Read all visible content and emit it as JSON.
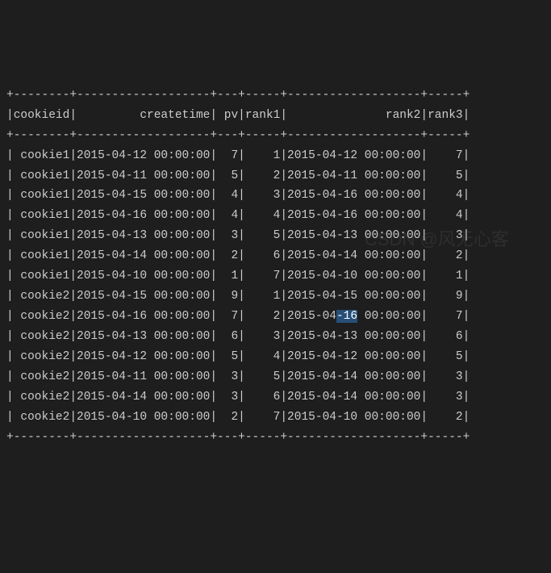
{
  "border": "+--------+-------------------+---+-----+-------------------+-----+",
  "header": "|cookieid|         createtime| pv|rank1|              rank2|rank3|",
  "watermark": "CSDN @风无心客",
  "highlight_row": 8,
  "highlight_text": "-16",
  "rows": [
    {
      "cookieid": "cookie1",
      "createtime": "2015-04-12 00:00:00",
      "pv": "7",
      "rank1": "1",
      "rank2": "2015-04-12 00:00:00",
      "rank3": "7"
    },
    {
      "cookieid": "cookie1",
      "createtime": "2015-04-11 00:00:00",
      "pv": "5",
      "rank1": "2",
      "rank2": "2015-04-11 00:00:00",
      "rank3": "5"
    },
    {
      "cookieid": "cookie1",
      "createtime": "2015-04-15 00:00:00",
      "pv": "4",
      "rank1": "3",
      "rank2": "2015-04-16 00:00:00",
      "rank3": "4"
    },
    {
      "cookieid": "cookie1",
      "createtime": "2015-04-16 00:00:00",
      "pv": "4",
      "rank1": "4",
      "rank2": "2015-04-16 00:00:00",
      "rank3": "4"
    },
    {
      "cookieid": "cookie1",
      "createtime": "2015-04-13 00:00:00",
      "pv": "3",
      "rank1": "5",
      "rank2": "2015-04-13 00:00:00",
      "rank3": "3"
    },
    {
      "cookieid": "cookie1",
      "createtime": "2015-04-14 00:00:00",
      "pv": "2",
      "rank1": "6",
      "rank2": "2015-04-14 00:00:00",
      "rank3": "2"
    },
    {
      "cookieid": "cookie1",
      "createtime": "2015-04-10 00:00:00",
      "pv": "1",
      "rank1": "7",
      "rank2": "2015-04-10 00:00:00",
      "rank3": "1"
    },
    {
      "cookieid": "cookie2",
      "createtime": "2015-04-15 00:00:00",
      "pv": "9",
      "rank1": "1",
      "rank2": "2015-04-15 00:00:00",
      "rank3": "9"
    },
    {
      "cookieid": "cookie2",
      "createtime": "2015-04-16 00:00:00",
      "pv": "7",
      "rank1": "2",
      "rank2": "2015-04-16 00:00:00",
      "rank3": "7"
    },
    {
      "cookieid": "cookie2",
      "createtime": "2015-04-13 00:00:00",
      "pv": "6",
      "rank1": "3",
      "rank2": "2015-04-13 00:00:00",
      "rank3": "6"
    },
    {
      "cookieid": "cookie2",
      "createtime": "2015-04-12 00:00:00",
      "pv": "5",
      "rank1": "4",
      "rank2": "2015-04-12 00:00:00",
      "rank3": "5"
    },
    {
      "cookieid": "cookie2",
      "createtime": "2015-04-11 00:00:00",
      "pv": "3",
      "rank1": "5",
      "rank2": "2015-04-14 00:00:00",
      "rank3": "3"
    },
    {
      "cookieid": "cookie2",
      "createtime": "2015-04-14 00:00:00",
      "pv": "3",
      "rank1": "6",
      "rank2": "2015-04-14 00:00:00",
      "rank3": "3"
    },
    {
      "cookieid": "cookie2",
      "createtime": "2015-04-10 00:00:00",
      "pv": "2",
      "rank1": "7",
      "rank2": "2015-04-10 00:00:00",
      "rank3": "2"
    }
  ]
}
